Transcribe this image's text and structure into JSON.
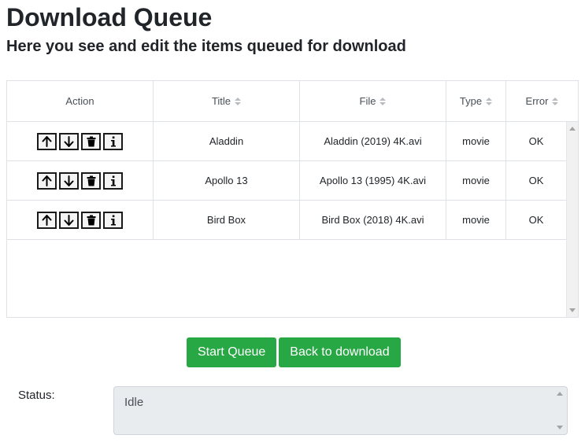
{
  "page": {
    "title": "Download Queue",
    "subtitle": "Here you see and edit the items queued for download"
  },
  "table": {
    "columns": [
      {
        "label": "Action",
        "sortable": false
      },
      {
        "label": "Title",
        "sortable": true
      },
      {
        "label": "File",
        "sortable": true
      },
      {
        "label": "Type",
        "sortable": true
      },
      {
        "label": "Error",
        "sortable": true
      }
    ],
    "row_action_icons": [
      "arrow-up-icon",
      "arrow-down-icon",
      "trash-icon",
      "info-icon"
    ],
    "rows": [
      {
        "title": "Aladdin",
        "file": "Aladdin (2019) 4K.avi",
        "type": "movie",
        "error": "OK"
      },
      {
        "title": "Apollo 13",
        "file": "Apollo 13 (1995) 4K.avi",
        "type": "movie",
        "error": "OK"
      },
      {
        "title": "Bird Box",
        "file": "Bird Box (2018) 4K.avi",
        "type": "movie",
        "error": "OK"
      }
    ]
  },
  "actions": {
    "start_label": "Start Queue",
    "back_label": "Back to download"
  },
  "status": {
    "label": "Status:",
    "value": "Idle"
  },
  "colors": {
    "accent_green": "#28a745",
    "readonly_bg": "#e9ecef"
  }
}
